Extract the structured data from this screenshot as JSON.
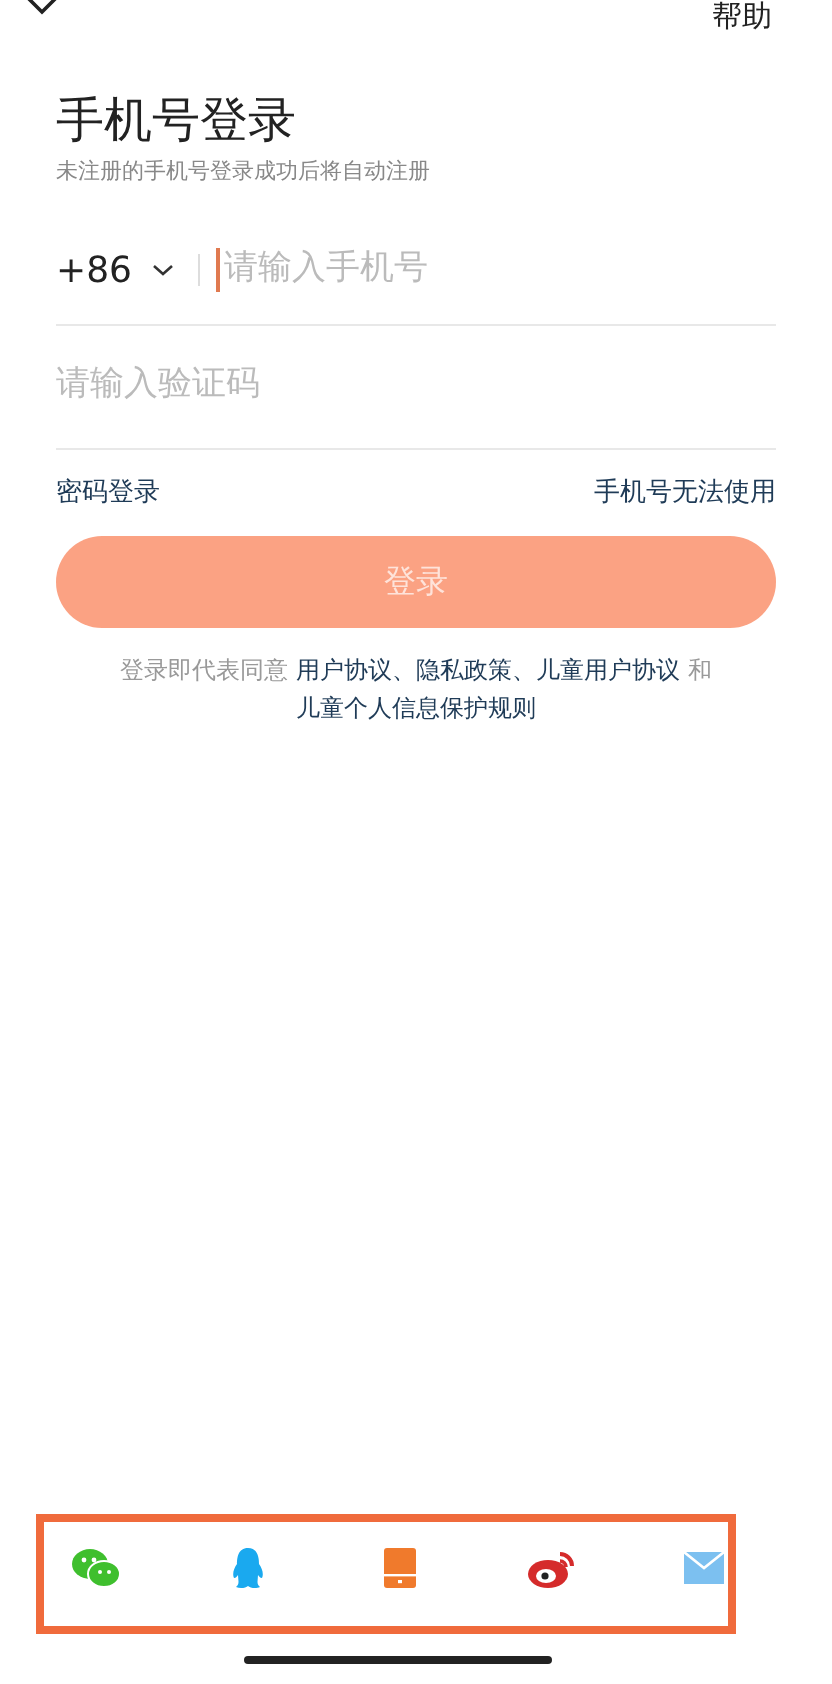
{
  "header": {
    "help": "帮助"
  },
  "title": "手机号登录",
  "subtitle": "未注册的手机号登录成功后将自动注册",
  "phone": {
    "country_code": "+86",
    "placeholder": "请输入手机号"
  },
  "code": {
    "placeholder": "请输入验证码"
  },
  "links": {
    "left": "密码登录",
    "right": "手机号无法使用"
  },
  "login_button": {
    "label": "登录",
    "disabled": true
  },
  "agreement": [
    {
      "kind": "text",
      "text": "登录即代表同意"
    },
    {
      "kind": "link",
      "text": "用户协议"
    },
    {
      "kind": "link",
      "text": "、"
    },
    {
      "kind": "link",
      "text": "隐私政策"
    },
    {
      "kind": "link",
      "text": "、"
    },
    {
      "kind": "link",
      "text": "儿童用户协议"
    },
    {
      "kind": "text",
      "text": "和"
    },
    {
      "kind": "link",
      "text": "儿童个人信息保护规则"
    }
  ],
  "social": [
    {
      "kind": "wechat"
    },
    {
      "kind": "qq"
    },
    {
      "kind": "phone"
    },
    {
      "kind": "weibo"
    },
    {
      "kind": "mail"
    }
  ]
}
